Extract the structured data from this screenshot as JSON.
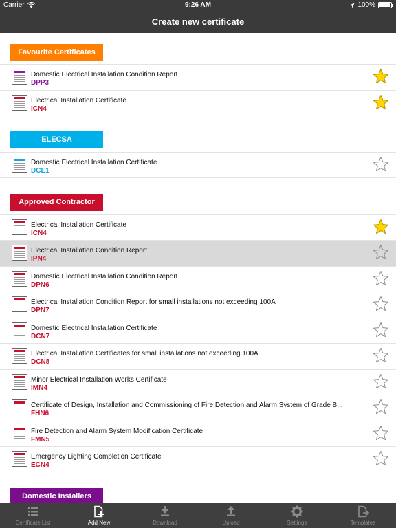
{
  "status": {
    "carrier": "Carrier",
    "time": "9:26 AM",
    "battery": "100%",
    "battery_level": 1.0
  },
  "nav": {
    "title": "Create new certificate"
  },
  "colors": {
    "favourite": "#ff8000",
    "elecsa": "#00b0e8",
    "approved": "#c8102e",
    "domestic": "#7a0f8c",
    "purple_code": "#8b1aa0",
    "red_code": "#c8102e",
    "blue_code": "#1aa6dd",
    "star_filled": "#ffd500"
  },
  "sections": [
    {
      "title": "Favourite Certificates",
      "color": "#ff8000",
      "items": [
        {
          "title": "Domestic Electrical Installation Condition Report",
          "code": "DPP3",
          "code_color": "#8b1aa0",
          "band_color": "#8b1aa0",
          "favourite": true,
          "selected": false
        },
        {
          "title": "Electrical Installation Certificate",
          "code": "ICN4",
          "code_color": "#c8102e",
          "band_color": "#c8102e",
          "favourite": true,
          "selected": false
        }
      ]
    },
    {
      "title": "ELECSA",
      "color": "#00b0e8",
      "items": [
        {
          "title": "Domestic Electrical Installation Certificate",
          "code": "DCE1",
          "code_color": "#1aa6dd",
          "band_color": "#1aa6dd",
          "favourite": false,
          "selected": false
        }
      ]
    },
    {
      "title": "Approved Contractor",
      "color": "#c8102e",
      "items": [
        {
          "title": "Electrical Installation Certificate",
          "code": "ICN4",
          "code_color": "#c8102e",
          "band_color": "#c8102e",
          "favourite": true,
          "selected": false
        },
        {
          "title": "Electrical Installation Condition Report",
          "code": "IPN4",
          "code_color": "#c8102e",
          "band_color": "#c8102e",
          "favourite": false,
          "selected": true
        },
        {
          "title": "Domestic Electrical Installation Condition Report",
          "code": "DPN6",
          "code_color": "#c8102e",
          "band_color": "#c8102e",
          "favourite": false,
          "selected": false
        },
        {
          "title": "Electrical Installation Condition Report for small installations not exceeding 100A",
          "code": "DPN7",
          "code_color": "#c8102e",
          "band_color": "#c8102e",
          "favourite": false,
          "selected": false
        },
        {
          "title": "Domestic Electrical Installation Certificate",
          "code": "DCN7",
          "code_color": "#c8102e",
          "band_color": "#c8102e",
          "favourite": false,
          "selected": false
        },
        {
          "title": "Electrical Installation Certificates for small installations not exceeding 100A",
          "code": "DCN8",
          "code_color": "#c8102e",
          "band_color": "#c8102e",
          "favourite": false,
          "selected": false
        },
        {
          "title": "Minor Electrical Installation Works Certificate",
          "code": "IMN4",
          "code_color": "#c8102e",
          "band_color": "#c8102e",
          "favourite": false,
          "selected": false
        },
        {
          "title": "Certificate of Design, Installation and Commissioning of Fire Detection and Alarm System of Grade B...",
          "code": "FHN6",
          "code_color": "#c8102e",
          "band_color": "#c8102e",
          "favourite": false,
          "selected": false
        },
        {
          "title": "Fire Detection and Alarm System Modification Certificate",
          "code": "FMN5",
          "code_color": "#c8102e",
          "band_color": "#c8102e",
          "favourite": false,
          "selected": false
        },
        {
          "title": "Emergency Lighting Completion Certificate",
          "code": "ECN4",
          "code_color": "#c8102e",
          "band_color": "#c8102e",
          "favourite": false,
          "selected": false
        }
      ]
    },
    {
      "title": "Domestic Installers",
      "color": "#7a0f8c",
      "items": []
    }
  ],
  "tabs": [
    {
      "label": "Certificate List",
      "icon": "list-icon",
      "active": false
    },
    {
      "label": "Add New",
      "icon": "add-document-icon",
      "active": true
    },
    {
      "label": "Download",
      "icon": "download-icon",
      "active": false
    },
    {
      "label": "Upload",
      "icon": "upload-icon",
      "active": false
    },
    {
      "label": "Settings",
      "icon": "gear-icon",
      "active": false
    },
    {
      "label": "Templates",
      "icon": "template-icon",
      "active": false
    }
  ]
}
